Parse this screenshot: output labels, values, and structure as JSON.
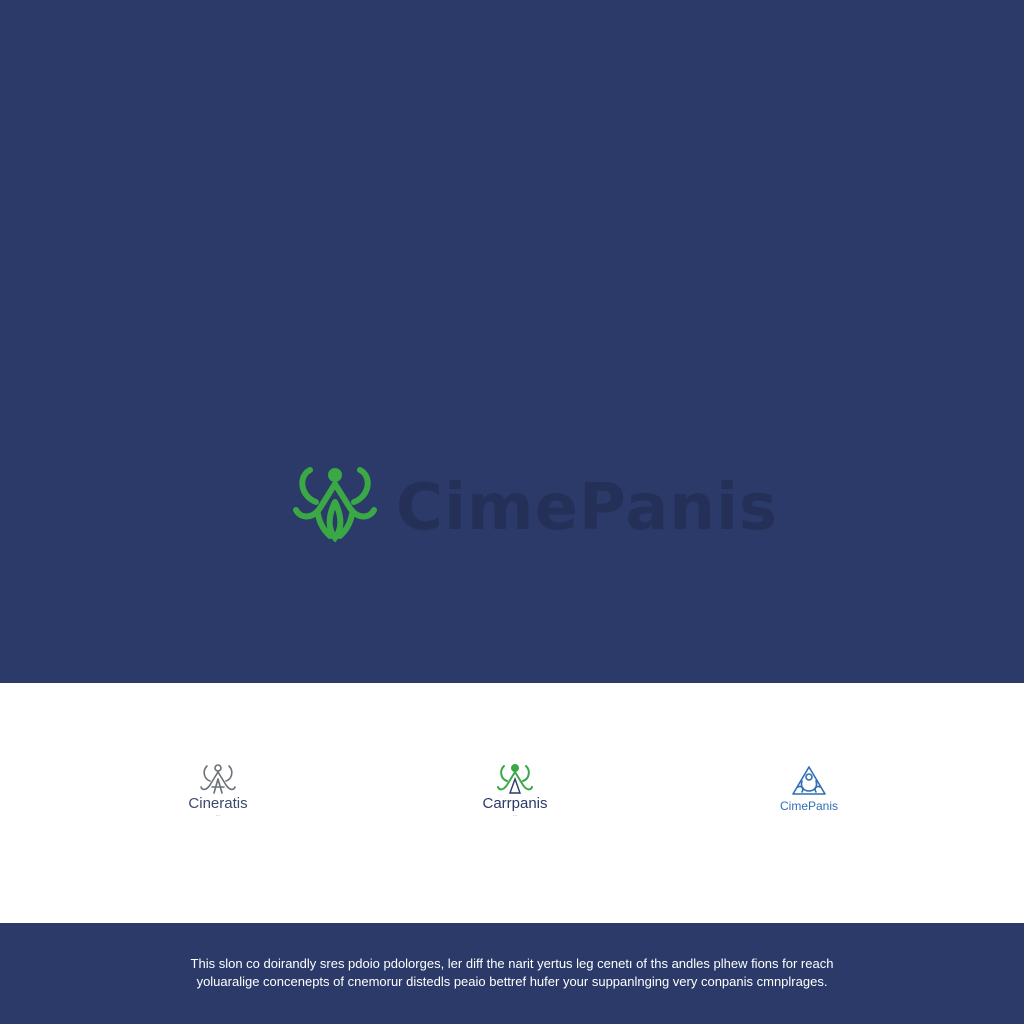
{
  "hero": {
    "brand_name": "CimePanis",
    "mark_icon": "leaf-figure-logo-icon",
    "background_color": "#2b3a68",
    "mark_color": "#3aa845",
    "wordmark_color": "#253058"
  },
  "variants": [
    {
      "name": "Cineratis",
      "tagline": "…",
      "icon": "grey-figure-logo-icon",
      "color": "#6b6f78"
    },
    {
      "name": "Carrpanis",
      "tagline": "…",
      "icon": "green-figure-logo-icon",
      "color": "#3aa845"
    },
    {
      "name": "CimePanis",
      "tagline": "",
      "icon": "blue-outline-logo-icon",
      "color": "#2f6fb4"
    }
  ],
  "footer": {
    "line1": "This slon co doirandly sres pdoio pdolorges, ler diff the narit yertus leg cenetı of ths andles plhew fions for reach",
    "line2": "yoluaralige concenepts of cnemorur distedls peaio bettref hufer your suppanlnging very conpanis cmnplrages."
  }
}
